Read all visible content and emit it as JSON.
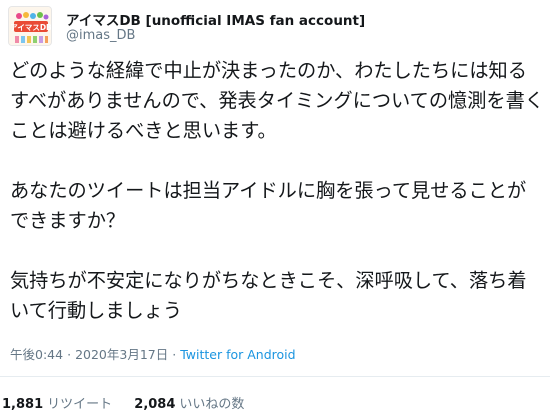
{
  "author": {
    "display_name": "アイマスDB [unofficial IMAS fan account]",
    "handle": "@imas_DB",
    "avatar_text": "アイマスDB",
    "avatar_icon": "imas-db-logo-icon"
  },
  "tweet": {
    "paragraphs": [
      "どのような経緯で中止が決まったのか、わたしたちには知るすべがありませんので、発表タイミングについての憶測を書くことは避けるべきと思います。",
      "あなたのツイートは担当アイドルに胸を張って見せることができますか？",
      "気持ちが不安定になりがちなときこそ、深呼吸して、落ち着いて行動しましょう"
    ]
  },
  "meta": {
    "time": "午後0:44",
    "separator": "·",
    "date": "2020年3月17日",
    "source": "Twitter for Android"
  },
  "stats": {
    "retweets_count": "1,881",
    "retweets_label": "リツイート",
    "likes_count": "2,084",
    "likes_label": "いいねの数"
  },
  "colors": {
    "text": "#14171a",
    "secondary": "#657786",
    "link": "#1b95e0",
    "divider": "#e6ecf0"
  }
}
